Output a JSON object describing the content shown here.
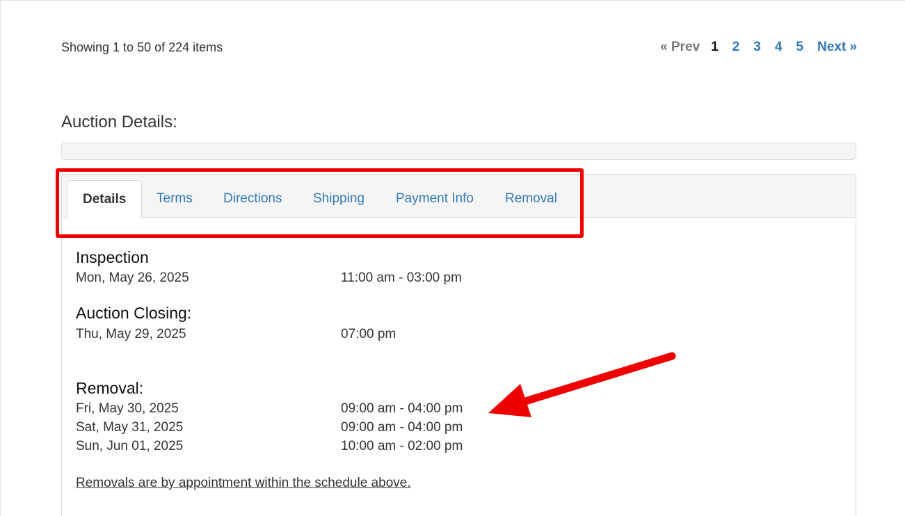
{
  "showing_text": "Showing 1 to 50 of 224 items",
  "pagination": {
    "prev": "« Prev",
    "pages": [
      "1",
      "2",
      "3",
      "4",
      "5"
    ],
    "current": "1",
    "next": "Next »"
  },
  "section_title": "Auction Details:",
  "tabs": [
    {
      "label": "Details",
      "active": true
    },
    {
      "label": "Terms",
      "active": false
    },
    {
      "label": "Directions",
      "active": false
    },
    {
      "label": "Shipping",
      "active": false
    },
    {
      "label": "Payment Info",
      "active": false
    },
    {
      "label": "Removal",
      "active": false
    }
  ],
  "inspection": {
    "title": "Inspection",
    "rows": [
      {
        "date": "Mon, May 26, 2025",
        "time": "11:00 am - 03:00 pm"
      }
    ]
  },
  "closing": {
    "title": "Auction Closing:",
    "rows": [
      {
        "date": "Thu, May 29, 2025",
        "time": "07:00 pm"
      }
    ]
  },
  "removal": {
    "title": "Removal:",
    "rows": [
      {
        "date": "Fri, May 30, 2025",
        "time": "09:00 am - 04:00 pm"
      },
      {
        "date": "Sat, May 31, 2025",
        "time": "09:00 am - 04:00 pm"
      },
      {
        "date": "Sun, Jun 01, 2025",
        "time": "10:00 am - 02:00 pm"
      }
    ]
  },
  "removal_note": "Removals are by appointment within the schedule above.",
  "colors": {
    "link": "#337ab7",
    "annotation": "#ee0000"
  }
}
